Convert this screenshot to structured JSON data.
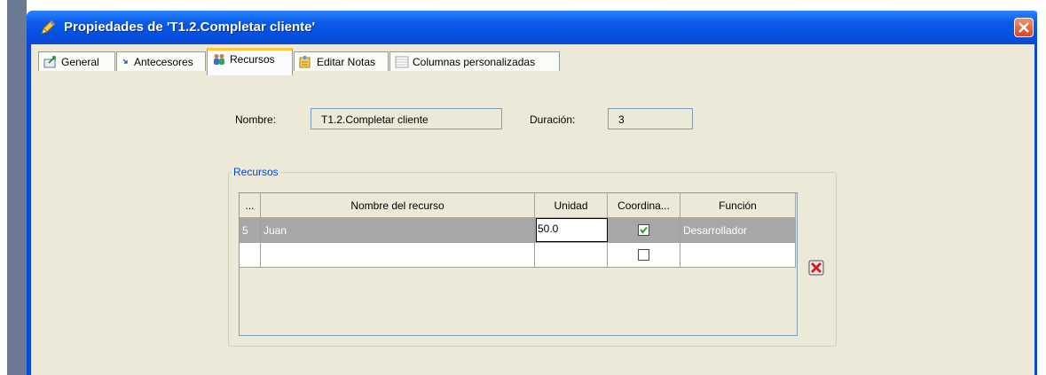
{
  "window": {
    "title": "Propiedades de 'T1.2.Completar cliente'",
    "accent": "#0a48d8",
    "title_icon": "pencil-icon"
  },
  "tabs": [
    {
      "label": "General",
      "icon": "general-icon"
    },
    {
      "label": "Antecesores",
      "icon": "arrow-icon"
    },
    {
      "label": "Recursos",
      "icon": "people-icon",
      "active": true
    },
    {
      "label": "Editar Notas",
      "icon": "notes-icon"
    },
    {
      "label": "Columnas personalizadas",
      "icon": "columns-icon"
    }
  ],
  "form": {
    "nombre_label": "Nombre:",
    "nombre_value": "T1.2.Completar cliente",
    "duracion_label": "Duración:",
    "duracion_value": "3"
  },
  "resources": {
    "group_title": "Recursos",
    "columns": [
      "...",
      "Nombre del recurso",
      "Unidad",
      "Coordina...",
      "Función"
    ],
    "rows": [
      {
        "id": "5",
        "name": "Juan",
        "unit": "50.0",
        "coordinator": true,
        "role": "Desarrollador"
      },
      {
        "id": "",
        "name": "",
        "unit": "",
        "coordinator": false,
        "role": ""
      }
    ],
    "remove_icon": "delete-icon"
  }
}
